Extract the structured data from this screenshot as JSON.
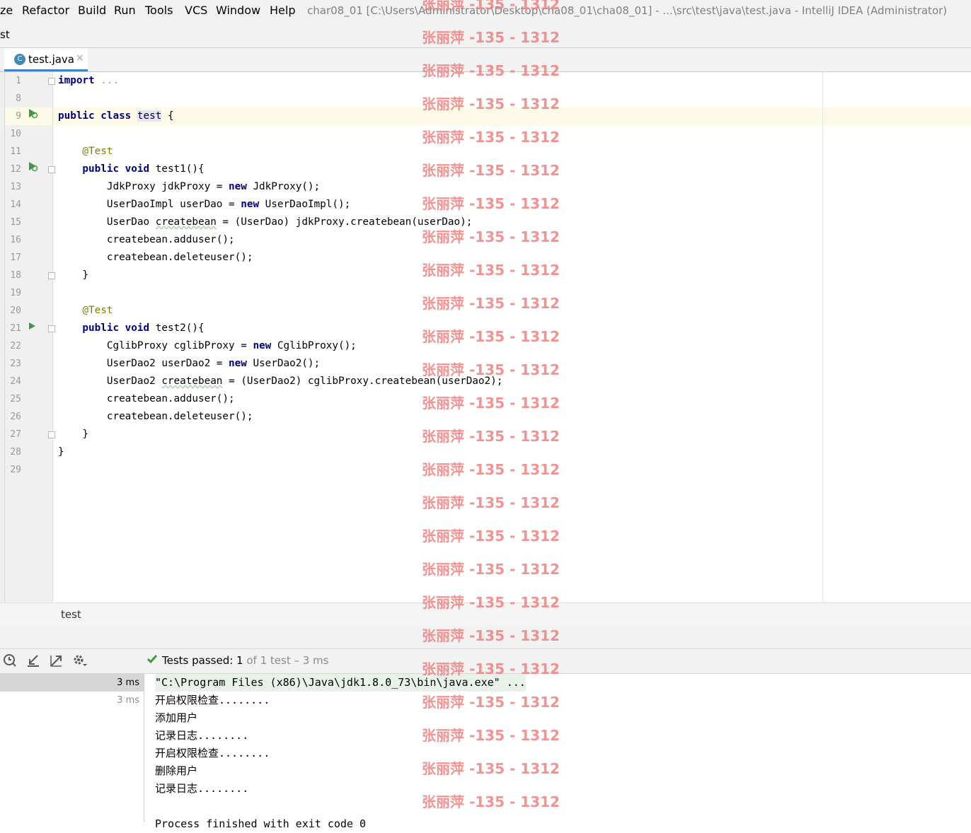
{
  "menubar": {
    "items": [
      "ze",
      "Refactor",
      "Build",
      "Run",
      "Tools",
      "VCS",
      "Window",
      "Help"
    ],
    "window_title": "char08_01 [C:\\Users\\Administrator\\Desktop\\cha08_01\\cha08_01] - ...\\src\\test\\java\\test.java - IntelliJ IDEA (Administrator)"
  },
  "navbar": {
    "label": "st"
  },
  "tab": {
    "file_icon": "C",
    "label": "test.java",
    "close_icon": "×"
  },
  "editor": {
    "line_numbers": [
      "1",
      "8",
      "9",
      "10",
      "11",
      "12",
      "13",
      "14",
      "15",
      "16",
      "17",
      "18",
      "19",
      "20",
      "21",
      "22",
      "23",
      "24",
      "25",
      "26",
      "27",
      "28",
      "29"
    ],
    "code": {
      "l1_kw": "import",
      "l1_rest": " ...",
      "l9_kw": "public class",
      "l9_cls": "test",
      "l9_rest": " {",
      "l11_ann": "    @Test",
      "l12_kw": "    public void",
      "l12_rest": " test1(){",
      "l13_a": "        JdkProxy jdkProxy = ",
      "l13_kw": "new",
      "l13_b": " JdkProxy();",
      "l14_a": "        UserDaoImpl userDao = ",
      "l14_kw": "new",
      "l14_b": " UserDaoImpl();",
      "l15_a": "        UserDao ",
      "l15_var": "createbean",
      "l15_b": " = (UserDao) jdkProxy.createbean(userDao);",
      "l16": "        createbean.adduser();",
      "l17": "        createbean.deleteuser();",
      "l18": "    }",
      "l20_ann": "    @Test",
      "l21_kw": "    public void",
      "l21_rest": " test2(){",
      "l22_a": "        CglibProxy cglibProxy = ",
      "l22_kw": "new",
      "l22_b": " CglibProxy();",
      "l23_a": "        UserDao2 userDao2 = ",
      "l23_kw": "new",
      "l23_b": " UserDao2();",
      "l24_a": "        UserDao2 ",
      "l24_var": "createbean",
      "l24_b": " = (UserDao2) cglibProxy.createbean(userDao2);",
      "l25": "        createbean.adduser();",
      "l26": "        createbean.deleteuser();",
      "l27": "    }",
      "l28": "}"
    }
  },
  "breadcrumb": {
    "label": "test"
  },
  "run_panel": {
    "status_prefix": "Tests passed: ",
    "status_count": "1",
    "status_suffix": " of 1 test – 3 ms",
    "tree_times": [
      "3 ms",
      "3 ms"
    ],
    "console_lines": [
      "\"C:\\Program Files (x86)\\Java\\jdk1.8.0_73\\bin\\java.exe\" ...",
      "开启权限检查........",
      "添加用户",
      "记录日志........",
      "开启权限检查........",
      "删除用户",
      "记录日志........",
      "Process finished with exit code 0"
    ]
  },
  "watermark": "张丽萍 -135 - 1312",
  "colors": {
    "accent": "#4083c9",
    "keyword": "#000080",
    "annotation": "#808000",
    "success": "#3e9a3e",
    "watermark": "#f08080"
  }
}
